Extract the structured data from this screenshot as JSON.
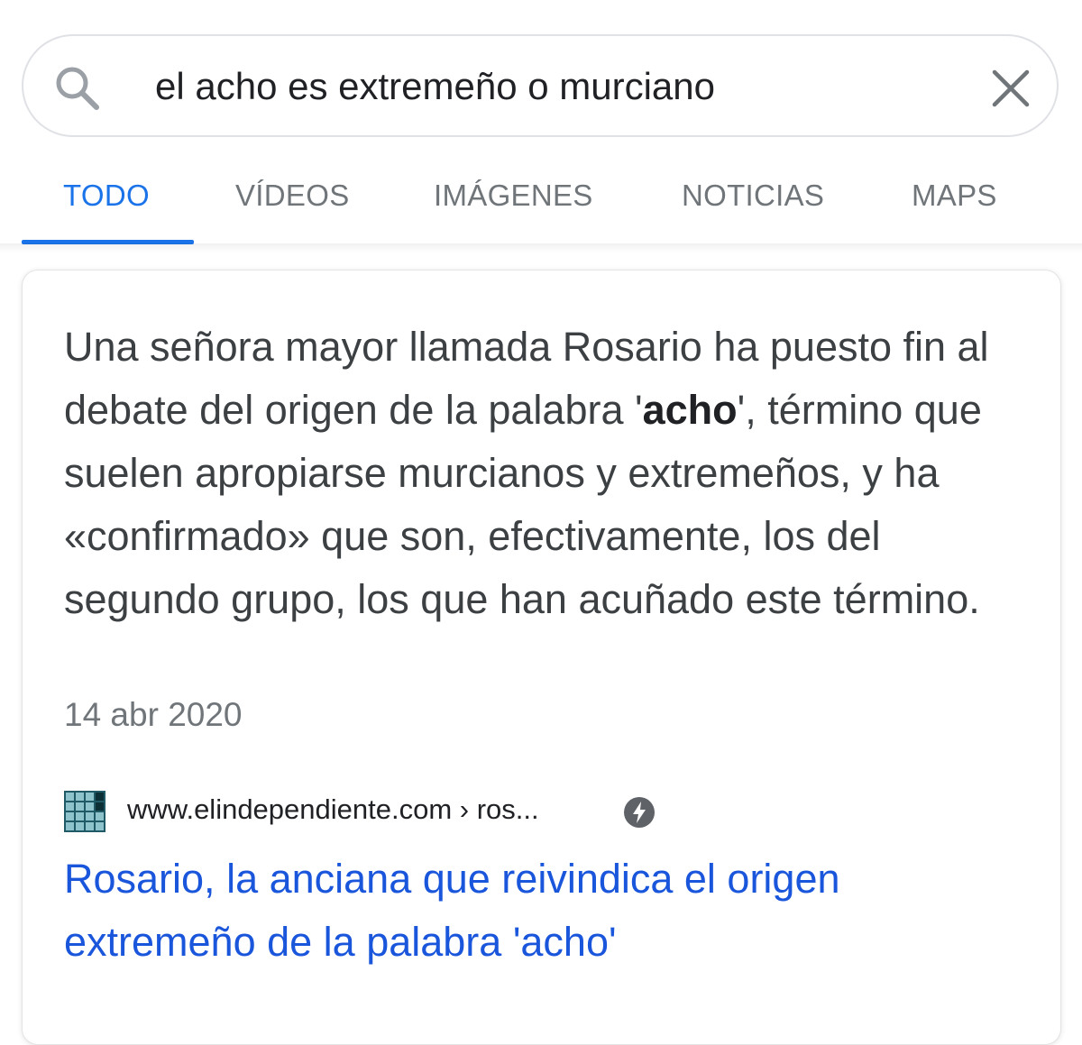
{
  "search": {
    "query": "el acho es extremeño o murciano"
  },
  "tabs": [
    {
      "label": "TODO",
      "active": true
    },
    {
      "label": "VÍDEOS",
      "active": false
    },
    {
      "label": "IMÁGENES",
      "active": false
    },
    {
      "label": "NOTICIAS",
      "active": false
    },
    {
      "label": "MAPS",
      "active": false
    }
  ],
  "snippet": {
    "text_before": "Una señora mayor llamada Rosario ha puesto fin al debate del origen de la palabra '",
    "highlight": "acho",
    "text_after": "', término que suelen apropiarse murcianos y extremeños, y ha «confirmado» que son, efectivamente, los del segundo grupo, los que han acuñado este término.",
    "date": "14 abr 2020"
  },
  "source": {
    "url": "www.elindependiente.com › ros..."
  },
  "result": {
    "title": "Rosario, la anciana que reivindica el origen extremeño de la palabra 'acho'"
  },
  "colors": {
    "accent": "#1a73e8",
    "link": "#1a56db",
    "text": "#3c4043",
    "muted": "#70757a",
    "border": "#dfe1e5"
  }
}
